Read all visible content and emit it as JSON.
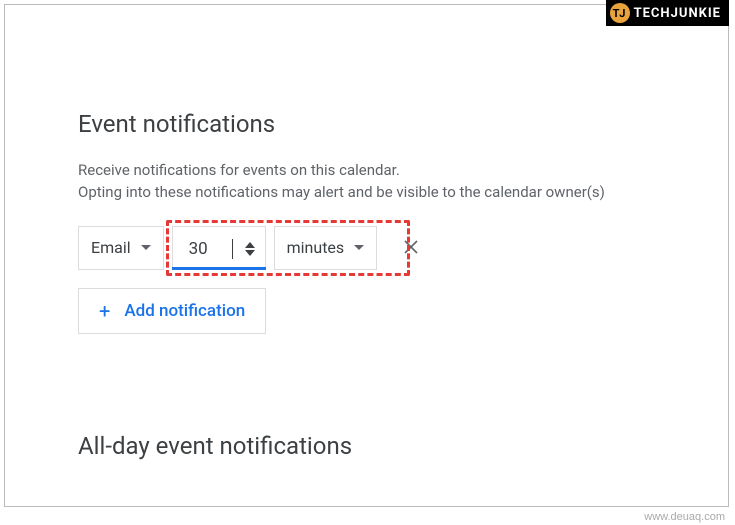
{
  "watermark": {
    "brand_badge": "TJ",
    "brand_text": "TECHJUNKIE",
    "url": "www.deuaq.com"
  },
  "eventNotifications": {
    "title": "Event notifications",
    "desc_line1": "Receive notifications for events on this calendar.",
    "desc_line2": "Opting into these notifications may alert and be visible to the calendar owner(s)",
    "row": {
      "method": "Email",
      "quantity": "30",
      "unit": "minutes"
    },
    "addButton": "Add notification"
  },
  "allDay": {
    "title": "All-day event notifications"
  }
}
